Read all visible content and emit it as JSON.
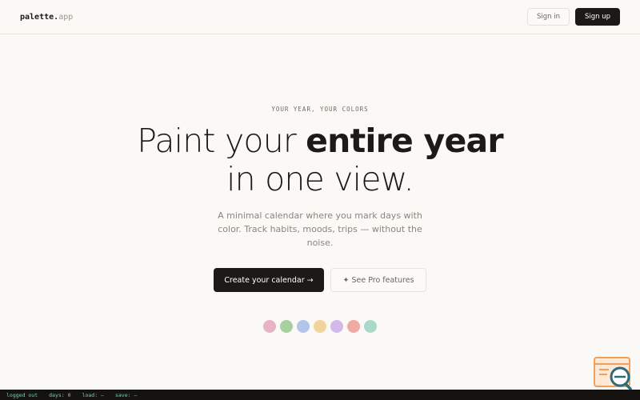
{
  "header": {
    "logo": {
      "name": "palette",
      "dot": ".",
      "tld": "app"
    },
    "signin_label": "Sign in",
    "signup_label": "Sign up"
  },
  "hero": {
    "eyebrow": "YOUR YEAR, YOUR COLORS",
    "headline_pre": "Paint your ",
    "headline_bold": "entire year",
    "headline_line2": "in one view.",
    "subtitle": "A minimal calendar where you mark days with color. Track habits, moods, trips — without the noise."
  },
  "cta": {
    "primary_label": "Create your calendar →",
    "secondary_label": "✦ See Pro features"
  },
  "swatches": [
    "#e8b4c4",
    "#a8cfa0",
    "#b3c4ea",
    "#f0d49c",
    "#d2b9ea",
    "#efaaa2",
    "#a9dac9"
  ],
  "statusbar": {
    "auth": "logged out",
    "days": "days: 0",
    "load": "load: –",
    "save": "save: –"
  },
  "colors": {
    "background": "#faf9f6",
    "ink": "#1c1a17",
    "muted": "#8a857e",
    "status_text": "#7fc9b4",
    "widget_accent": "#f0a05a"
  },
  "widget_icon": "browser-search-icon"
}
